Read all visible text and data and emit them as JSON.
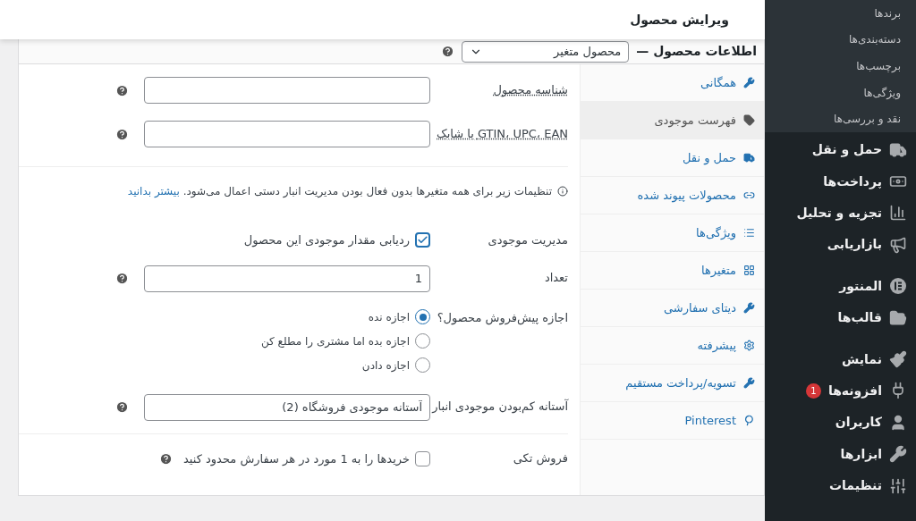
{
  "sidebar": {
    "submenu": [
      "برندها",
      "دسته‌بندی‌ها",
      "برچسب‌ها",
      "ویژگی‌ها",
      "نقد و بررسی‌ها"
    ],
    "groups": [
      [
        {
          "label": "حمل و نقل",
          "kind": "truck"
        },
        {
          "label": "پرداخت‌ها",
          "kind": "money"
        },
        {
          "label": "تجزیه و تحلیل",
          "kind": "chart"
        },
        {
          "label": "بازاریابی",
          "kind": "megaphone"
        }
      ],
      [
        {
          "label": "المنتور",
          "kind": "elementor"
        },
        {
          "label": "قالب‌ها",
          "kind": "folder"
        }
      ],
      [
        {
          "label": "نمایش",
          "kind": "brush"
        },
        {
          "label": "افزونه‌ها",
          "kind": "plug",
          "badge": "1"
        },
        {
          "label": "کاربران",
          "kind": "user"
        },
        {
          "label": "ابزارها",
          "kind": "wrench"
        },
        {
          "label": "تنظیمات",
          "kind": "sliders"
        }
      ]
    ]
  },
  "header": {
    "title": "ویرایش محصول"
  },
  "product_data": {
    "label": "اطلاعات محصول —",
    "type_select": "محصول متغیر"
  },
  "tabs": [
    {
      "label": "همگانی",
      "kind": "wrench",
      "selected": false
    },
    {
      "label": "فهرست موجودی",
      "kind": "tag",
      "selected": true
    },
    {
      "label": "حمل و نقل",
      "kind": "truck",
      "selected": false
    },
    {
      "label": "محصولات پیوند شده",
      "kind": "link",
      "selected": false
    },
    {
      "label": "ویژگی‌ها",
      "kind": "list",
      "selected": false
    },
    {
      "label": "متغیرها",
      "kind": "grid",
      "selected": false
    },
    {
      "label": "دیتای سفارشی",
      "kind": "wrench",
      "selected": false
    },
    {
      "label": "پیشرفته",
      "kind": "gear",
      "selected": false
    },
    {
      "label": "تسویه/پرداخت مستقیم",
      "kind": "wrench",
      "selected": false
    },
    {
      "label": "Pinterest",
      "kind": "pinterest",
      "selected": false
    }
  ],
  "inventory": {
    "sku_label": "شناسه محصول",
    "gtin_label": "GTIN، UPC، EAN یا شابک",
    "notice": "تنظیمات زیر برای همه متغیرها بدون فعال بودن مدیریت انبار دستی اعمال می‌شود.",
    "notice_link": "بیشتر بدانید",
    "manage_stock": {
      "label": "مدیریت موجودی",
      "checkbox_label": "ردیابی مقدار موجودی این محصول",
      "checked": true
    },
    "quantity": {
      "label": "تعداد",
      "value": "1"
    },
    "backorders": {
      "label": "اجازه پیش‌فروش محصول؟",
      "options": [
        {
          "label": "اجازه نده",
          "selected": true
        },
        {
          "label": "اجازه بده اما مشتری را مطلع کن",
          "selected": false
        },
        {
          "label": "اجازه دادن",
          "selected": false
        }
      ]
    },
    "low_stock": {
      "label": "آستانه کم‌بودن موجودی انبار",
      "placeholder": "آستانه موجودی فروشگاه (2)"
    },
    "sold_individually": {
      "label": "فروش تکی",
      "checkbox_label": "خریدها را به 1 مورد در هر سفارش محدود کنید",
      "checked": false
    }
  }
}
